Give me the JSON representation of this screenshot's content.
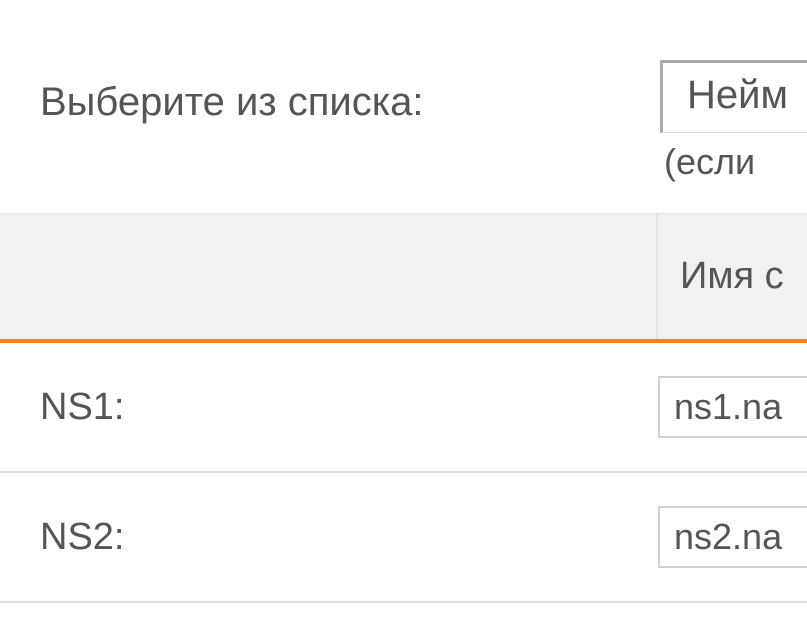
{
  "top": {
    "select_label": "Выберите из списка:",
    "dropdown_value": "Нейм",
    "hint": "(если "
  },
  "table": {
    "header_right": "Имя с",
    "rows": [
      {
        "label": "NS1:",
        "value": "ns1.na"
      },
      {
        "label": "NS2:",
        "value": "ns2.na"
      }
    ]
  }
}
